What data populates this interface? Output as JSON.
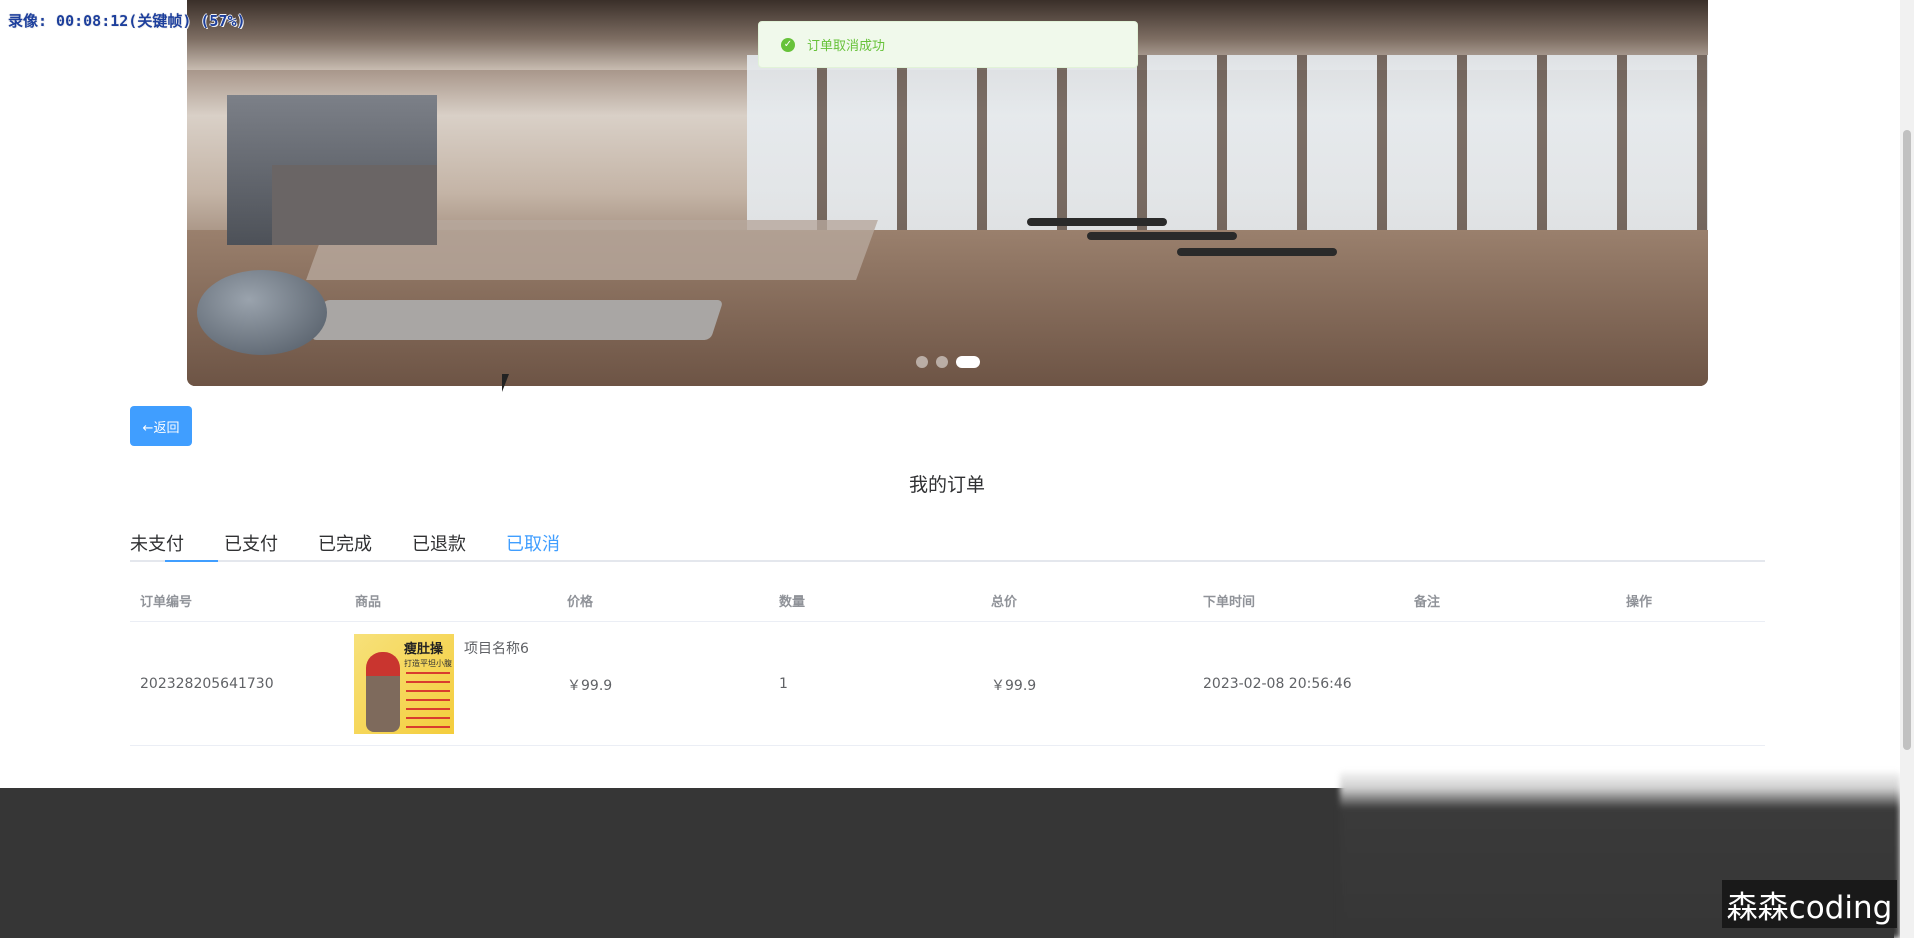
{
  "recording": {
    "status": "录像: 00:08:12(关键帧) (57%)"
  },
  "banner": {
    "slide_count": 3,
    "active_slide": 3
  },
  "toast": {
    "message": "订单取消成功",
    "type": "success"
  },
  "back_button": {
    "label": "←返回"
  },
  "page_title": "我的订单",
  "tabs": [
    {
      "label": "未支付",
      "underlined": true
    },
    {
      "label": "已支付"
    },
    {
      "label": "已完成"
    },
    {
      "label": "已退款"
    },
    {
      "label": "已取消",
      "selected": true
    }
  ],
  "table": {
    "headers": [
      "订单编号",
      "商品",
      "价格",
      "数量",
      "总价",
      "下单时间",
      "备注",
      "操作"
    ],
    "rows": [
      {
        "order_no": "202328205641730",
        "product_image": {
          "title": "瘦肚操",
          "subtitle": "打造平坦小腹"
        },
        "product_name": "项目名称6",
        "price": "￥99.9",
        "quantity": "1",
        "total": "￥99.9",
        "order_time": "2023-02-08 20:56:46",
        "remark": "",
        "actions": ""
      }
    ]
  },
  "watermark": "森森coding",
  "colors": {
    "primary": "#409eff",
    "success": "#67c23a",
    "footer": "#363636"
  }
}
